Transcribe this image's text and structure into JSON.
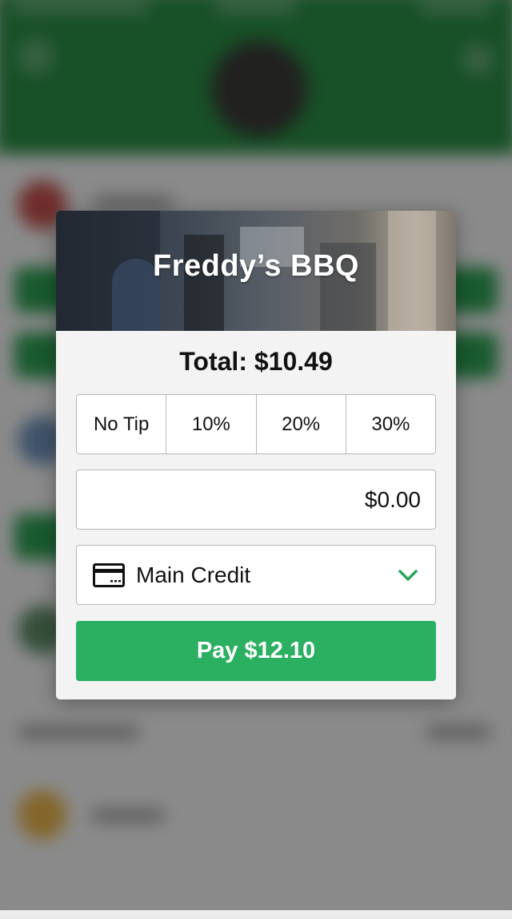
{
  "modal": {
    "restaurant_name": "Freddy’s BBQ",
    "total_text": "Total: $10.49",
    "tip_options": [
      "No Tip",
      "10%",
      "20%",
      "30%"
    ],
    "tip_amount": "$0.00",
    "payment_method": {
      "label": "Main Credit",
      "icon": "credit-card-icon",
      "dropdown_icon": "chevron-down-icon"
    },
    "pay_button_label": "Pay $12.10"
  },
  "colors": {
    "header_green": "#2a8a45",
    "pay_green": "#2bb061",
    "chevron_green": "#27a85a"
  }
}
